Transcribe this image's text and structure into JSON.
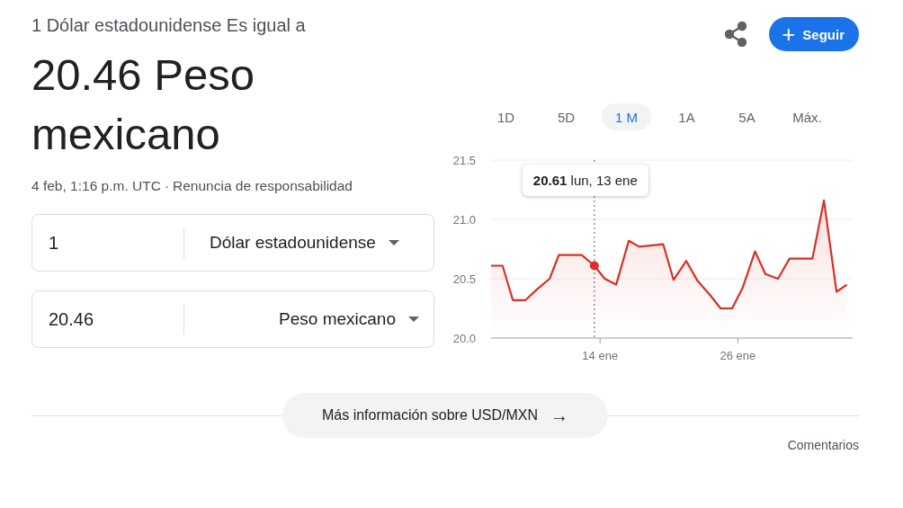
{
  "summary": {
    "caption": "1 Dólar estadounidense Es igual a",
    "result": "20.46 Peso mexicano",
    "timestamp": "4 feb, 1:16 p.m. UTC",
    "separator": "·",
    "disclaimer": "Renuncia de responsabilidad"
  },
  "actions": {
    "follow_icon": "+",
    "follow": "Seguir"
  },
  "converter": [
    {
      "amount": "1",
      "currency": "Dólar estadounidense"
    },
    {
      "amount": "20.46",
      "currency": "Peso mexicano"
    }
  ],
  "ranges": [
    {
      "label": "1D",
      "selected": false
    },
    {
      "label": "5D",
      "selected": false
    },
    {
      "label": "1 M",
      "selected": true
    },
    {
      "label": "1A",
      "selected": false
    },
    {
      "label": "5A",
      "selected": false
    },
    {
      "label": "Máx.",
      "selected": false
    }
  ],
  "chart": {
    "tooltip": "**20.61** lun, 13 ene",
    "chart_data": {
      "type": "area",
      "x": [
        4.5,
        5.5,
        6.4,
        7.5,
        8.5,
        9.6,
        10.4,
        12.4,
        13.5,
        14.4,
        15.4,
        16.5,
        17.4,
        19.5,
        20.4,
        21.5,
        22.5,
        23.6,
        24.5,
        25.5,
        26.4,
        27.5,
        28.4,
        29.5,
        30.5,
        32.5,
        33.5,
        34.6,
        35.5
      ],
      "ref_lines": [
        {
          "axis": "x",
          "value": 13.5
        }
      ],
      "series": [
        {
          "color": "#d93025",
          "values": [
            20.61,
            20.61,
            20.32,
            20.32,
            20.41,
            20.5,
            20.7,
            20.7,
            20.61,
            20.5,
            20.45,
            20.82,
            20.77,
            20.79,
            20.49,
            20.65,
            20.48,
            20.36,
            20.25,
            20.25,
            20.42,
            20.73,
            20.54,
            20.5,
            20.67,
            20.67,
            21.16,
            20.39,
            20.45
          ]
        }
      ],
      "xlim": [
        4.5,
        36
      ],
      "ylim": [
        20,
        21.5
      ],
      "xticks": [
        {
          "value": 14,
          "label": "14 ene"
        },
        {
          "value": 26,
          "label": "26 ene"
        }
      ],
      "yticks": [
        {
          "value": 20,
          "label": "20.0"
        },
        {
          "value": 20.5,
          "label": "20.5"
        },
        {
          "value": 21,
          "label": "21.0"
        },
        {
          "value": 21.5,
          "label": "21.5"
        }
      ]
    }
  },
  "more": {
    "label": "Más información sobre USD/MXN",
    "arrow": "→"
  },
  "feedback": "Comentarios"
}
